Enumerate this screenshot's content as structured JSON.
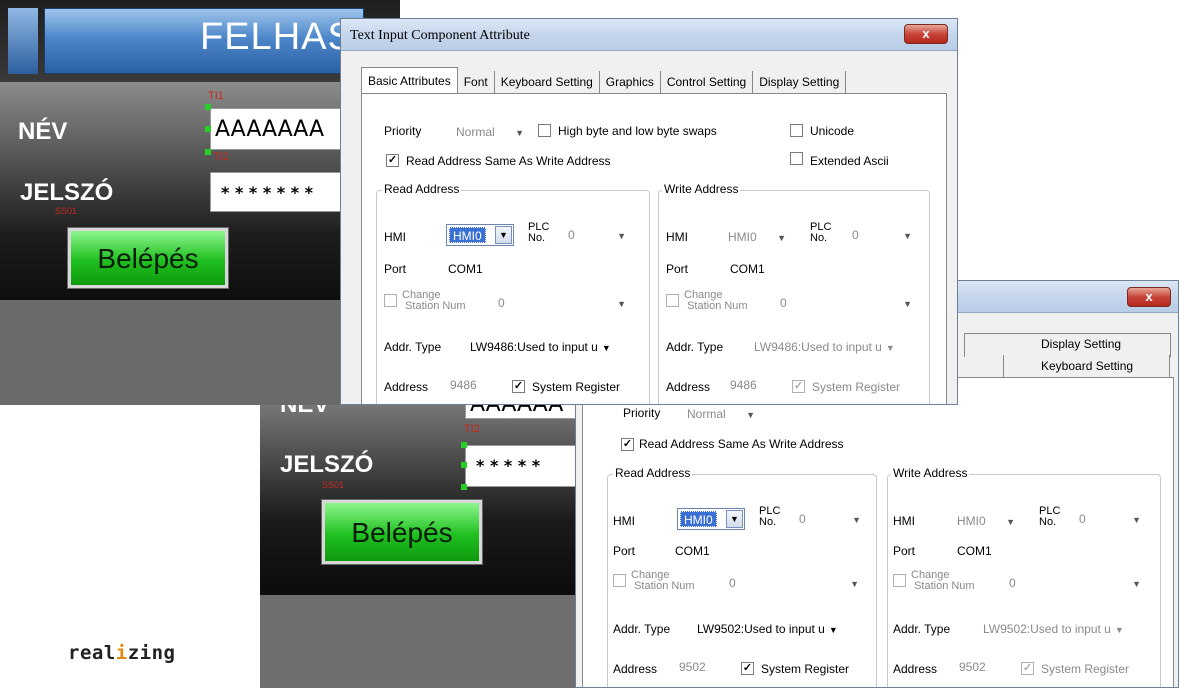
{
  "hmi_top": {
    "banner_title": "FELHAS",
    "name_label": "NÉV",
    "name_value": "AAAAAAA",
    "password_label": "JELSZÓ",
    "password_value": "* * * * * * *",
    "login_button": "Belépés",
    "tag_ti1": "TI1",
    "tag_ti2": "TI2",
    "tag_ss": "SS01"
  },
  "hmi_bottom": {
    "name_label": "NÉV",
    "name_value": "AAAAAA",
    "password_label": "JELSZÓ",
    "password_value": "* * * * *",
    "login_button": "Belépés",
    "tag_ti2": "TI2",
    "tag_ss": "SS01"
  },
  "logo": {
    "prefix": "real",
    "highlight": "i",
    "suffix": "zing"
  },
  "dialog1": {
    "title": "Text Input Component Attribute",
    "close_label": "x",
    "tabs": [
      "Basic Attributes",
      "Font",
      "Keyboard Setting",
      "Graphics",
      "Control Setting",
      "Display Setting"
    ],
    "priority_label": "Priority",
    "priority_value": "Normal",
    "swap_label": "High byte and low byte swaps",
    "unicode_label": "Unicode",
    "same_address_label": "Read Address Same As Write Address",
    "extended_ascii_label": "Extended Ascii",
    "read": {
      "title": "Read Address",
      "hmi_label": "HMI",
      "hmi_value": "HMI0",
      "plc_label_1": "PLC",
      "plc_label_2": "No.",
      "plc_value": "0",
      "port_label": "Port",
      "port_value": "COM1",
      "change_label_1": "Change",
      "change_label_2": "Station Num",
      "change_value": "0",
      "addr_type_label": "Addr. Type",
      "addr_type_value": "LW9486:Used to input u",
      "address_label": "Address",
      "address_value": "9486",
      "system_register_label": "System Register"
    },
    "write": {
      "title": "Write Address",
      "hmi_label": "HMI",
      "hmi_value": "HMI0",
      "plc_label_1": "PLC",
      "plc_label_2": "No.",
      "plc_value": "0",
      "port_label": "Port",
      "port_value": "COM1",
      "change_label_1": "Change",
      "change_label_2": "Station Num",
      "change_value": "0",
      "addr_type_label": "Addr. Type",
      "addr_type_value": "LW9486:Used to input u",
      "address_label": "Address",
      "address_value": "9486",
      "system_register_label": "System Register"
    }
  },
  "dialog2": {
    "close_label": "x",
    "tab_display": "Display Setting",
    "tab_keyboard": "Keyboard Setting",
    "priority_label": "Priority",
    "priority_value": "Normal",
    "same_address_label": "Read Address Same As Write Address",
    "read": {
      "title": "Read Address",
      "hmi_label": "HMI",
      "hmi_value": "HMI0",
      "plc_label_1": "PLC",
      "plc_label_2": "No.",
      "plc_value": "0",
      "port_label": "Port",
      "port_value": "COM1",
      "change_label_1": "Change",
      "change_label_2": "Station Num",
      "change_value": "0",
      "addr_type_label": "Addr. Type",
      "addr_type_value": "LW9502:Used to input u",
      "address_label": "Address",
      "address_value": "9502",
      "system_register_label": "System Register"
    },
    "write": {
      "title": "Write Address",
      "hmi_label": "HMI",
      "hmi_value": "HMI0",
      "plc_label_1": "PLC",
      "plc_label_2": "No.",
      "plc_value": "0",
      "port_label": "Port",
      "port_value": "COM1",
      "change_label_1": "Change",
      "change_label_2": "Station Num",
      "change_value": "0",
      "addr_type_label": "Addr. Type",
      "addr_type_value": "LW9502:Used to input u",
      "address_label": "Address",
      "address_value": "9502",
      "system_register_label": "System Register"
    }
  }
}
